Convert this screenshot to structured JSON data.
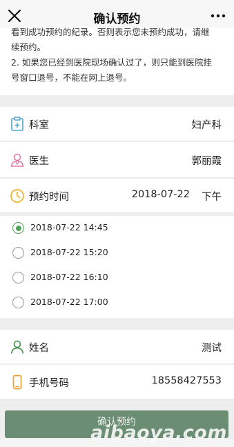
{
  "header": {
    "title": "确认预约",
    "close_icon": "close-icon",
    "more_icon": "more-dots-icon"
  },
  "notice": {
    "line0": "看到成功预约的纪录。否则表示您未预约成功，请继",
    "line1": "续预约。",
    "line2": "2. 如果您已经到医院现场确认过了，则只能到医院挂",
    "line3": "号窗口退号，不能在网上退号。"
  },
  "info": {
    "department_label": "科室",
    "department_value": "妇产科",
    "doctor_label": "医生",
    "doctor_value": "郭丽霞",
    "time_label": "预约时间",
    "time_date": "2018-07-22",
    "time_period": "下午"
  },
  "slots": [
    {
      "label": "2018-07-22 14:45",
      "selected": true
    },
    {
      "label": "2018-07-22 15:20",
      "selected": false
    },
    {
      "label": "2018-07-22 16:10",
      "selected": false
    },
    {
      "label": "2018-07-22 17:00",
      "selected": false
    }
  ],
  "patient": {
    "name_label": "姓名",
    "name_value": "测试",
    "phone_label": "手机号码",
    "phone_value": "18558427553"
  },
  "actions": {
    "confirm_label": "确认预约"
  },
  "watermark": "aibaoya.com",
  "colors": {
    "accent_green": "#55a35a",
    "button_bg": "#6b8d74",
    "icon_blue": "#4fa3c8",
    "icon_pink": "#e07aa0",
    "icon_yellow": "#f0b429",
    "icon_green": "#4a9a55",
    "icon_orange": "#f0a030"
  }
}
